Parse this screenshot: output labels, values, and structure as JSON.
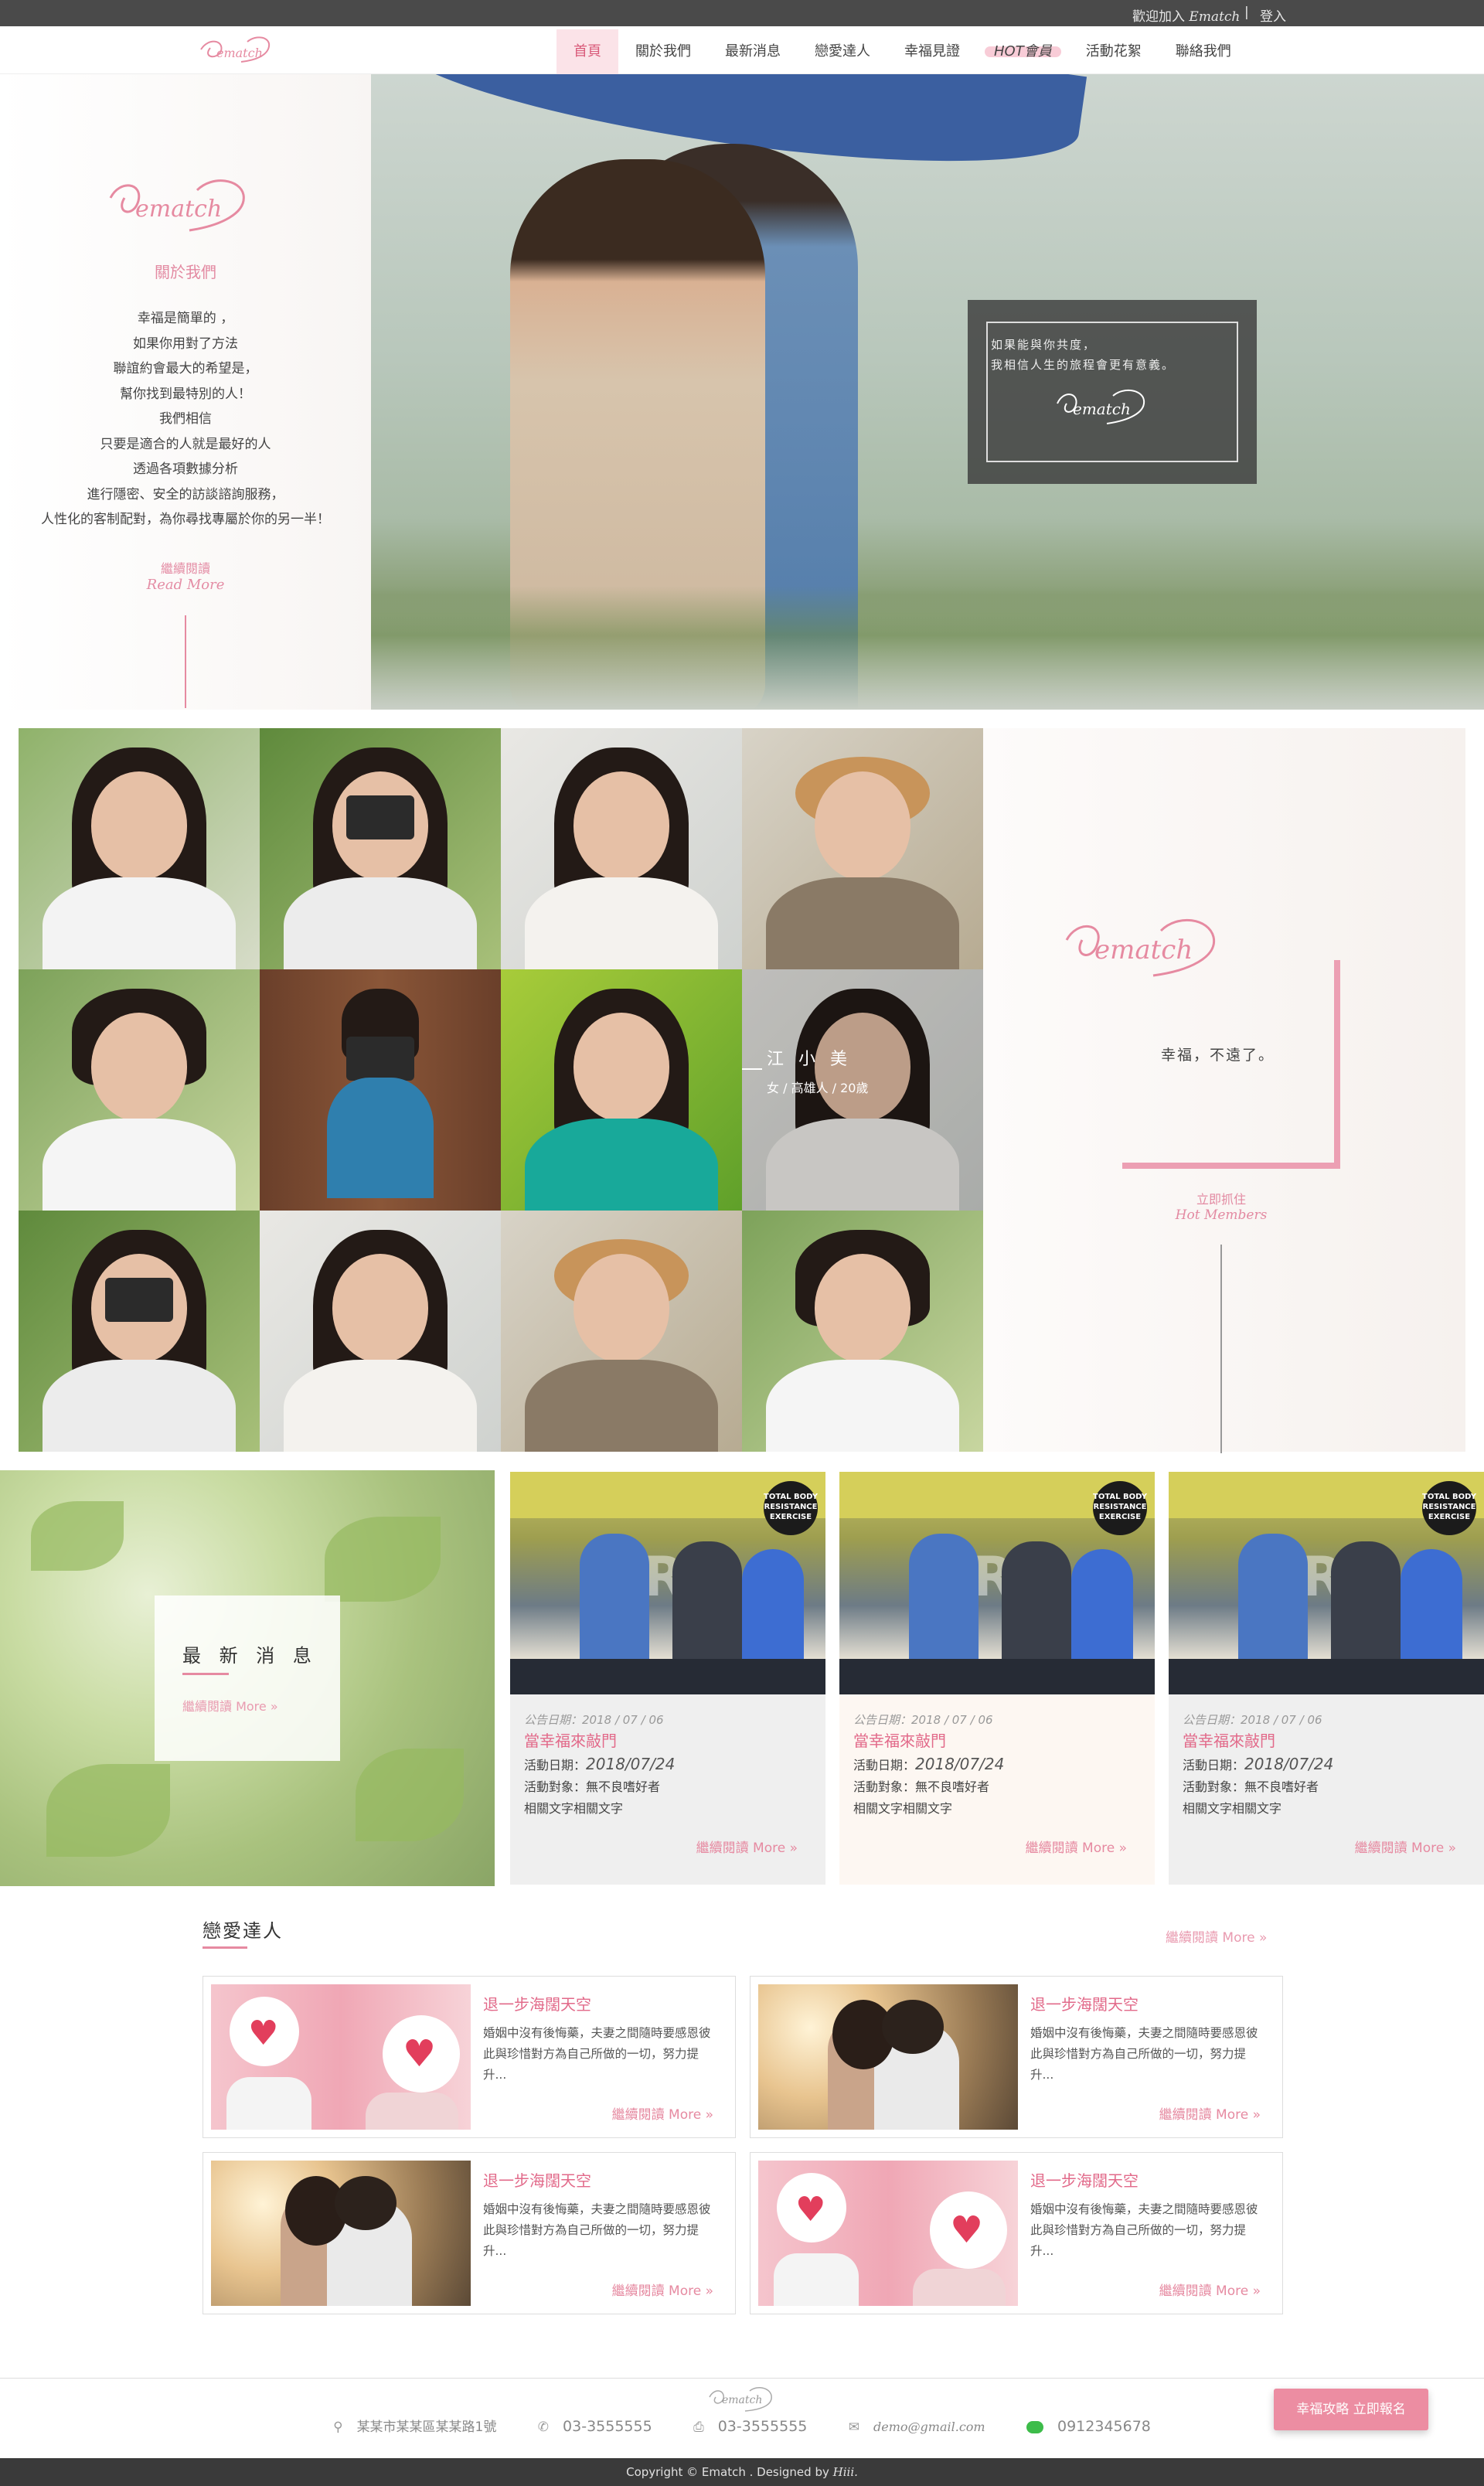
{
  "topbar": {
    "welcome_prefix": "歡迎加入",
    "welcome_brand": "Ematch",
    "separator": "|",
    "login": "登入"
  },
  "brand": {
    "logo_text": "ematch"
  },
  "nav": {
    "items": [
      "首頁",
      "關於我們",
      "最新消息",
      "戀愛達人",
      "幸福見證",
      "HOT會員",
      "活動花絮",
      "聯絡我們"
    ],
    "active": "首頁",
    "accent": "#fbe3e8"
  },
  "about": {
    "heading": "關於我們",
    "lines": [
      "幸福是簡單的 ，",
      "如果你用對了方法",
      "聯誼約會最大的希望是，",
      "幫你找到最特別的人！",
      "我們相信",
      "只要是適合的人就是最好的人",
      "透過各項數據分析",
      "進行隱密、安全的訪談諮詢服務，",
      "人性化的客制配對，為你尋找專屬於你的另一半！"
    ],
    "more_zh": "繼續閱讀",
    "more_en": "Read More"
  },
  "hero": {
    "quote_line1": "如果能與你共度，",
    "quote_line2": "我相信人生的旅程會更有意義。"
  },
  "members": {
    "featured_name": "江 小 美",
    "featured_meta": "女 / 高雄人 / 20歲",
    "slogan": "幸福，不遠了。",
    "cta_zh": "立即抓住",
    "cta_en": "Hot Members"
  },
  "news": {
    "heading": "最 新 消 息",
    "more": "繼續閱讀 More »",
    "cards": [
      {
        "date": "公告日期：2018 / 07 / 06",
        "title": "當幸福來敲門",
        "event_label": "活動日期：",
        "event_date": "2018/07/24",
        "target": "活動對象：無不良嗜好者",
        "desc": "相關文字相關文字",
        "more": "繼續閱讀 More »",
        "badge": "TOTAL BODY RESISTANCE EXERCISE",
        "bg": "#efefef"
      },
      {
        "date": "公告日期：2018 / 07 / 06",
        "title": "當幸福來敲門",
        "event_label": "活動日期：",
        "event_date": "2018/07/24",
        "target": "活動對象：無不良嗜好者",
        "desc": "相關文字相關文字",
        "more": "繼續閱讀 More »",
        "badge": "TOTAL BODY RESISTANCE EXERCISE",
        "bg": "#fdf7f2"
      },
      {
        "date": "公告日期：2018 / 07 / 06",
        "title": "當幸福來敲門",
        "event_label": "活動日期：",
        "event_date": "2018/07/24",
        "target": "活動對象：無不良嗜好者",
        "desc": "相關文字相關文字",
        "more": "繼續閱讀 More »",
        "badge": "TOTAL BODY RESISTANCE EXERCISE",
        "bg": "#efefef"
      }
    ]
  },
  "love": {
    "heading": "戀愛達人",
    "more": "繼續閱讀 More »",
    "cards": [
      {
        "title": "退一步海闊天空",
        "text": "婚姻中沒有後悔藥，夫妻之間隨時要感恩彼此與珍惜對方為自己所做的一切，努力提升...",
        "more": "繼續閱讀 More »"
      },
      {
        "title": "退一步海闊天空",
        "text": "婚姻中沒有後悔藥，夫妻之間隨時要感恩彼此與珍惜對方為自己所做的一切，努力提升...",
        "more": "繼續閱讀 More »"
      },
      {
        "title": "退一步海闊天空",
        "text": "婚姻中沒有後悔藥，夫妻之間隨時要感恩彼此與珍惜對方為自己所做的一切，努力提升...",
        "more": "繼續閱讀 More »"
      },
      {
        "title": "退一步海闊天空",
        "text": "婚姻中沒有後悔藥，夫妻之間隨時要感恩彼此與珍惜對方為自己所做的一切，努力提升...",
        "more": "繼續閱讀 More »"
      }
    ]
  },
  "footer": {
    "address": "某某市某某區某某路1號",
    "phone": "03-3555555",
    "fax": "03-3555555",
    "email": "demo@gmail.com",
    "line": "0912345678",
    "signup": "幸福攻略 立即報名",
    "copyright_prefix": "Copyright © Ematch . Designed by",
    "copyright_designer": "Hiii."
  },
  "colors": {
    "accent": "#e68aa1",
    "title_pink": "#e26a8a",
    "topbar": "#4a4a4a"
  }
}
